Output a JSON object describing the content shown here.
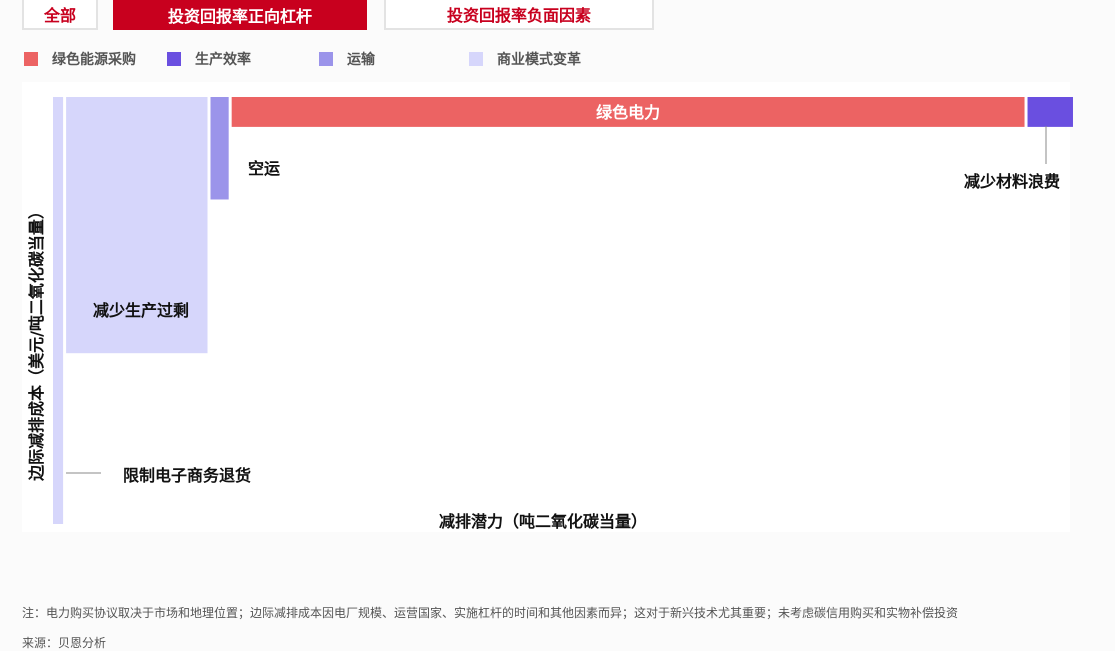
{
  "tabs": [
    {
      "label": "全部"
    },
    {
      "label": "投资回报率正向杠杆"
    },
    {
      "label": "投资回报率负面因素"
    }
  ],
  "colors": {
    "accent": "#c8001e",
    "green_energy": "#ec6363",
    "production_efficiency": "#6a4fe0",
    "transport": "#9b94ea",
    "business_model": "#d6d6fb"
  },
  "chart_data": {
    "type": "bar",
    "subtype": "marginal-abatement-cost-curve",
    "xlabel": "减排潜力（吨二氧化碳当量）",
    "ylabel": "边际减排成本（美元/吨二氧化碳当量）",
    "legend": [
      {
        "name": "绿色能源采购",
        "color": "#ec6363"
      },
      {
        "name": "生产效率",
        "color": "#6a4fe0"
      },
      {
        "name": "运输",
        "color": "#9b94ea"
      },
      {
        "name": "商业模式变革",
        "color": "#d6d6fb"
      }
    ],
    "legend_position": "top-left",
    "grid": false,
    "axes_ticks": false,
    "bars": [
      {
        "label": "限制电子商务退货",
        "category": "商业模式变革",
        "width": 1.0,
        "height": 100,
        "color": "#d6d6fb"
      },
      {
        "label": "减少生产过剩",
        "category": "商业模式变革",
        "width": 14.0,
        "height": 60,
        "color": "#d6d6fb"
      },
      {
        "label": "空运",
        "category": "运输",
        "width": 1.8,
        "height": 24,
        "color": "#9b94ea"
      },
      {
        "label": "绿色电力",
        "category": "绿色能源采购",
        "width": 78.5,
        "height": 7,
        "color": "#ec6363"
      },
      {
        "label": "减少材料浪费",
        "category": "生产效率",
        "width": 4.5,
        "height": 7,
        "color": "#6a4fe0"
      }
    ]
  },
  "note": "注：电力购买协议取决于市场和地理位置；边际减排成本因电厂规模、运营国家、实施杠杆的时间和其他因素而异；这对于新兴技术尤其重要；未考虑碳信用购买和实物补偿投资",
  "source": "来源：贝恩分析"
}
